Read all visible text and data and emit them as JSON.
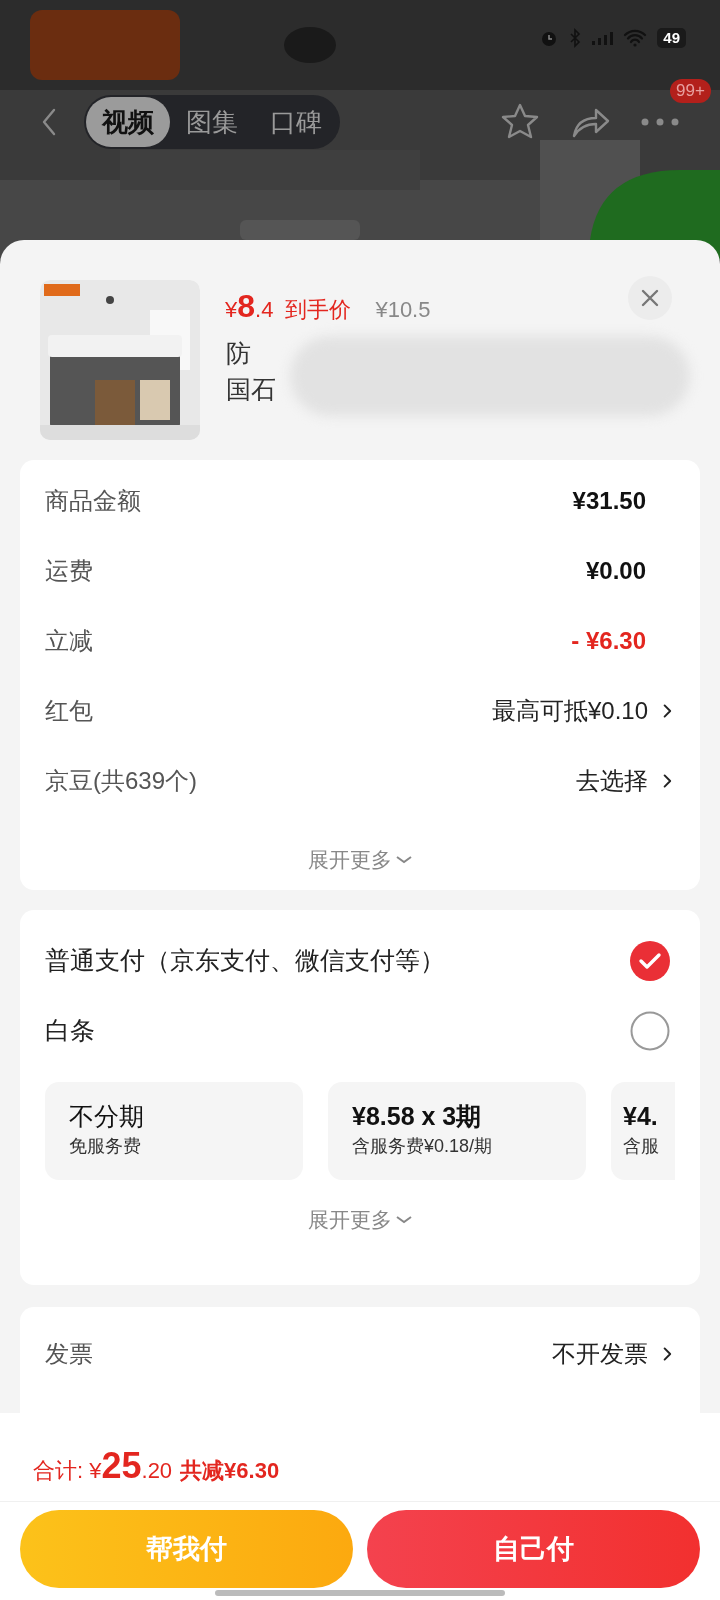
{
  "status_bar": {
    "battery": "49"
  },
  "nav": {
    "tabs": [
      {
        "label": "视频",
        "selected": true
      },
      {
        "label": "图集",
        "selected": false
      },
      {
        "label": "口碑",
        "selected": false
      }
    ],
    "badge": "99+"
  },
  "product": {
    "price_symbol": "¥",
    "price_int": "8",
    "price_dec": ".4",
    "price_label": "到手价",
    "original_price": "¥10.5",
    "title_lines": [
      "防",
      "国石"
    ]
  },
  "costs": {
    "rows": [
      {
        "label": "商品金额",
        "value": "¥31.50",
        "kind": "plain"
      },
      {
        "label": "运费",
        "value": "¥0.00",
        "kind": "plain"
      },
      {
        "label": "立减",
        "value": "- ¥6.30",
        "kind": "discount"
      },
      {
        "label": "红包",
        "value": "最高可抵¥0.10",
        "kind": "link"
      },
      {
        "label": "京豆(共639个)",
        "value": "去选择",
        "kind": "link"
      }
    ],
    "expand": "展开更多"
  },
  "payment": {
    "options": [
      {
        "label": "普通支付（京东支付、微信支付等）",
        "selected": true
      },
      {
        "label": "白条",
        "selected": false
      }
    ],
    "plans": [
      {
        "title": "不分期",
        "subtitle": "免服务费"
      },
      {
        "title": "¥8.58 x 3期",
        "subtitle": "含服务费¥0.18/期"
      },
      {
        "title": "¥4.",
        "subtitle": "含服"
      }
    ],
    "expand": "展开更多"
  },
  "invoice": {
    "label": "发票",
    "value": "不开发票"
  },
  "footer": {
    "total_label": "合计: ¥",
    "total_int": "25",
    "total_dec": ".20",
    "saved": "共减¥6.30",
    "buttons": [
      "帮我付",
      "自己付"
    ]
  }
}
